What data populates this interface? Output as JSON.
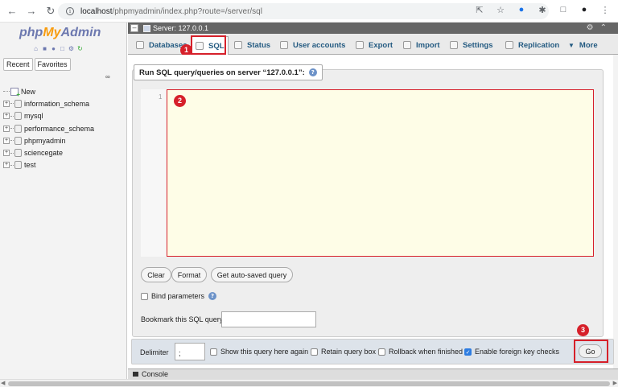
{
  "browser": {
    "url_host": "localhost",
    "url_path": "/phpmyadmin/index.php?route=/server/sql",
    "icons": [
      "back-arrow-icon",
      "forward-arrow-icon",
      "reload-icon",
      "info-icon",
      "share-icon",
      "star-icon",
      "extension-icon",
      "puzzle-icon",
      "tab-icon",
      "profile-icon",
      "more-icon"
    ]
  },
  "sidebar": {
    "logo": {
      "php": "php",
      "my": "My",
      "admin": "Admin"
    },
    "tabs": [
      "Recent",
      "Favorites"
    ],
    "databases": [
      "New",
      "information_schema",
      "mysql",
      "performance_schema",
      "phpmyadmin",
      "sciencegate",
      "test"
    ]
  },
  "breadcrumb": {
    "server": "Server: 127.0.0.1"
  },
  "tabs": [
    {
      "label": "Databases"
    },
    {
      "label": "SQL"
    },
    {
      "label": "Status"
    },
    {
      "label": "User accounts"
    },
    {
      "label": "Export"
    },
    {
      "label": "Import"
    },
    {
      "label": "Settings"
    },
    {
      "label": "Replication"
    },
    {
      "label": "More"
    }
  ],
  "sql_panel": {
    "legend": "Run SQL query/queries on server “127.0.0.1”:",
    "line_number": "1",
    "buttons": {
      "clear": "Clear",
      "format": "Format",
      "autosaved": "Get auto-saved query"
    },
    "bind_parameters": "Bind parameters",
    "bookmark_label": "Bookmark this SQL query:"
  },
  "footer": {
    "delimiter_label": "Delimiter",
    "delimiter_value": ";",
    "options": [
      {
        "label": "Show this query here again",
        "checked": false
      },
      {
        "label": "Retain query box",
        "checked": false
      },
      {
        "label": "Rollback when finished",
        "checked": false
      },
      {
        "label": "Enable foreign key checks",
        "checked": true
      }
    ],
    "go_label": "Go"
  },
  "console": {
    "label": "Console"
  },
  "annotations": {
    "badge1": "1",
    "badge2": "2",
    "badge3": "3",
    "highlight_color": "#d6202a"
  }
}
